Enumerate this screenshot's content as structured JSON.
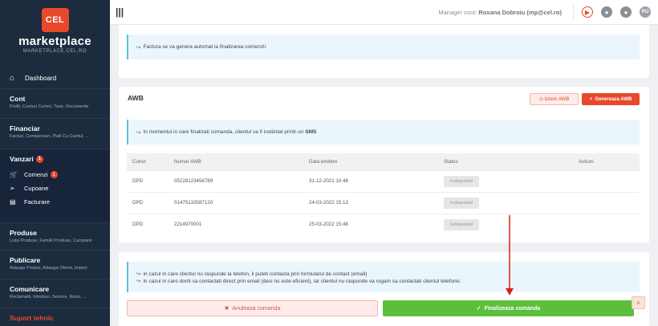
{
  "brand": {
    "logo": "CEL",
    "name": "marketplace",
    "sub": "MARKETPLACE.CEL.RO"
  },
  "sidebar": {
    "dashboard": "Dashboard",
    "sections": [
      {
        "title": "Cont",
        "sub": "Profil, Conturi Curieri, Taxe, Documente"
      },
      {
        "title": "Financiar",
        "sub": "Facturi, Compensari, Plati Cu Cardul, ..."
      },
      {
        "title": "Vanzari",
        "badge": "1"
      },
      {
        "title": "Produse",
        "sub": "Lista Produse, Familii Produse, Campanii"
      },
      {
        "title": "Publicare",
        "sub": "Adauga Produs, Adauga Oferta, Import"
      },
      {
        "title": "Comunicare",
        "sub": "Reclamatii, Intrebari, Service, Retur, ..."
      },
      {
        "title": "Suport tehnic"
      }
    ],
    "vanzari_items": [
      {
        "label": "Comenzi",
        "badge": "1"
      },
      {
        "label": "Cupoane"
      },
      {
        "label": "Facturare"
      }
    ]
  },
  "topbar": {
    "manager_prefix": "Manager cont:",
    "manager_name": "Roxana Dobroiu (mp@cel.ro)",
    "avatar": "RO"
  },
  "invoice_info": "Factura se va genera automat la finalizarea comenzii.",
  "awb": {
    "title": "AWB",
    "istoric_label": "Istoric AWB",
    "genereaza_label": "Genereaza AWB",
    "info_text": "In momentul in care finalizati comanda, clientul va fi instiintat printr-un",
    "info_bold": "SMS",
    "columns": [
      "Curier",
      "Numar AWB",
      "Data emitere",
      "Status",
      "Actiuni"
    ],
    "rows": [
      {
        "curier": "DPD",
        "numar": "05228123456789",
        "data": "31-12-2021 10:48",
        "status": "Indisponibil"
      },
      {
        "curier": "DPD",
        "numar": "01475133587120",
        "data": "24-03-2022 15:13",
        "status": "Indisponibil"
      },
      {
        "curier": "DPD",
        "numar": "2214970001",
        "data": "25-03-2022 15:48",
        "status": "Indisponibil"
      }
    ]
  },
  "contact_info": {
    "line1": "in cazul in care clientul nu raspunde la telefon, il puteti contacta prin formularul de contact (email)",
    "line2": "in cazul in care doriti sa contactati direct prin email (desi nu este eficient), iar clientul nu raspunde va rugam sa contactati clientul telefonic"
  },
  "actions": {
    "anuleaza": "Anuleaza comanda",
    "finalizeaza": "Finalizeaza comanda"
  },
  "colors": {
    "accent": "#e8492b",
    "sidebar": "#1c2b3d",
    "success": "#5cbf3c"
  }
}
